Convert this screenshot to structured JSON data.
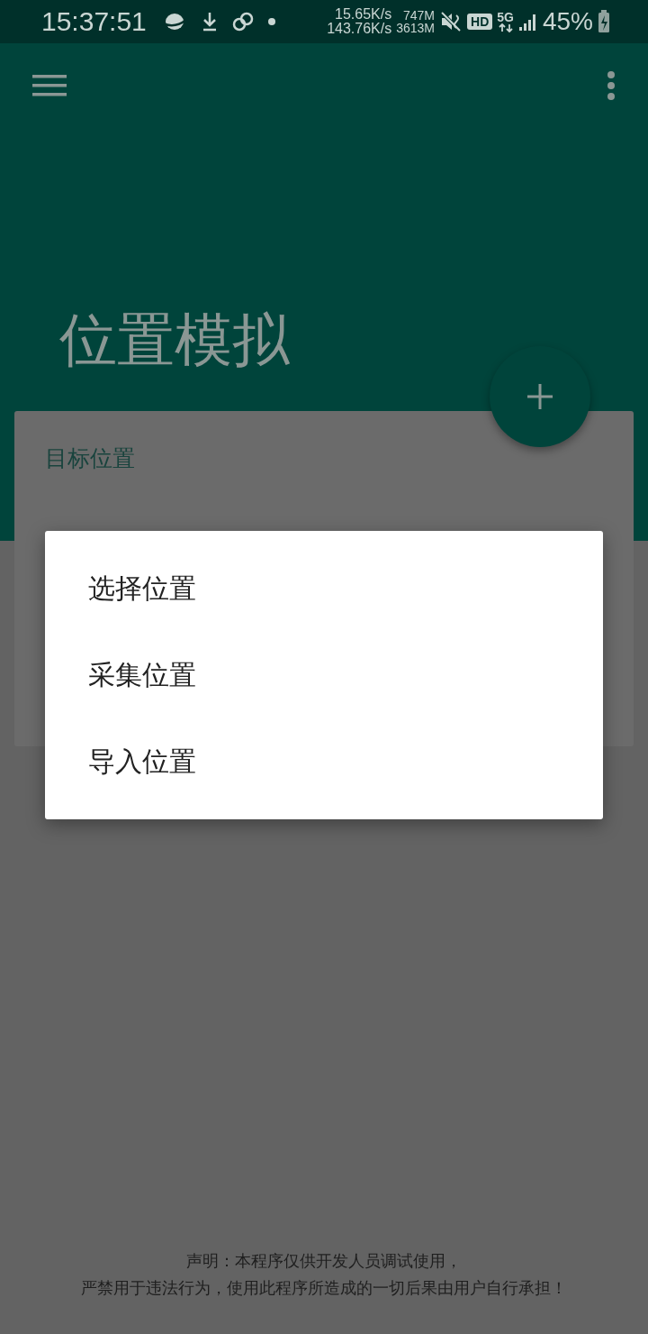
{
  "status_bar": {
    "time": "15:37:51",
    "speed_up": "15.65K/s",
    "speed_down": "143.76K/s",
    "memory_1": "747M",
    "memory_2": "3613M",
    "hd": "HD",
    "network": "5G",
    "battery": "45%"
  },
  "app_bar": {
    "title": "位置模拟"
  },
  "card": {
    "label": "目标位置"
  },
  "dialog": {
    "items": [
      {
        "label": "选择位置"
      },
      {
        "label": "采集位置"
      },
      {
        "label": "导入位置"
      }
    ]
  },
  "disclaimer": [
    "声明：本程序仅供开发人员调试使用，",
    "严禁用于违法行为，使用此程序所造成的一切后果由用户自行承担！"
  ]
}
